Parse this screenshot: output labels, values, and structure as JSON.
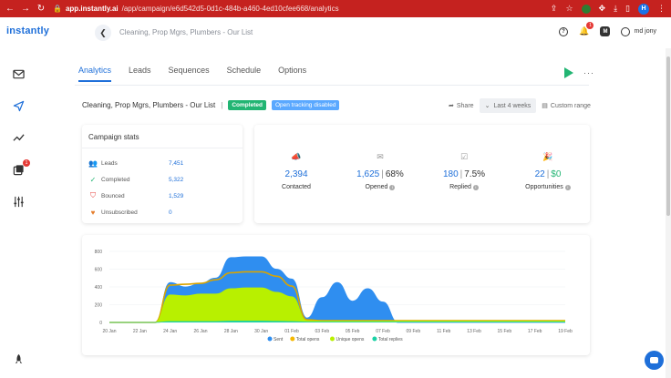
{
  "browser": {
    "domain": "app.instantly.ai",
    "path": "/app/campaign/e6d542d5-0d1c-484b-a460-4ed10cfee668/analytics",
    "notification_count": "1",
    "profile_initial": "H"
  },
  "header": {
    "logo": "instantly",
    "campaign_title": "Cleaning, Prop Mgrs, Plumbers - Our List",
    "notification_count": "1",
    "workspace_initial": "M",
    "user_name": "md jony"
  },
  "sidebar": {
    "items": [
      {
        "name": "inbox-icon"
      },
      {
        "name": "send-icon"
      },
      {
        "name": "analytics-icon"
      },
      {
        "name": "unibox-icon",
        "badge": "1"
      },
      {
        "name": "settings-sliders-icon"
      },
      {
        "name": "rocket-icon"
      }
    ]
  },
  "tabs": [
    {
      "label": "Analytics",
      "active": true
    },
    {
      "label": "Leads",
      "active": false
    },
    {
      "label": "Sequences",
      "active": false
    },
    {
      "label": "Schedule",
      "active": false
    },
    {
      "label": "Options",
      "active": false
    }
  ],
  "campaign": {
    "name": "Cleaning, Prop Mgrs, Plumbers - Our List",
    "separator": "|",
    "status": "Completed",
    "tracking": "Open tracking disabled",
    "share_label": "Share",
    "range_label": "Last 4 weeks",
    "custom_range_label": "Custom range"
  },
  "stats": {
    "title": "Campaign stats",
    "rows": [
      {
        "label": "Leads",
        "value": "7,451"
      },
      {
        "label": "Completed",
        "value": "5,322"
      },
      {
        "label": "Bounced",
        "value": "1,529"
      },
      {
        "label": "Unsubscribed",
        "value": "0"
      }
    ]
  },
  "metrics": {
    "contacted": {
      "value": "2,394",
      "label": "Contacted"
    },
    "opened": {
      "value": "1,625",
      "pct": "68%",
      "label": "Opened"
    },
    "replied": {
      "value": "180",
      "pct": "7.5%",
      "label": "Replied"
    },
    "opportunities": {
      "value": "22",
      "money": "$0",
      "label": "Opportunities"
    }
  },
  "colors": {
    "accent": "#1e6fd9",
    "success": "#22b573",
    "sent": "#2f8ef0",
    "total_opens": "#f5b800",
    "unique_opens": "#b8f000",
    "total_replies": "#1ad1a5"
  },
  "chart_data": {
    "type": "area",
    "ylim": [
      0,
      800
    ],
    "yticks": [
      "0",
      "200",
      "400",
      "600",
      "800"
    ],
    "x": [
      "20 Jan",
      "21 Jan",
      "22 Jan",
      "23 Jan",
      "24 Jan",
      "25 Jan",
      "26 Jan",
      "27 Jan",
      "28 Jan",
      "29 Jan",
      "30 Jan",
      "31 Jan",
      "01 Feb",
      "02 Feb",
      "03 Feb",
      "04 Feb",
      "05 Feb",
      "06 Feb",
      "07 Feb",
      "08 Feb",
      "09 Feb",
      "10 Feb",
      "11 Feb",
      "12 Feb",
      "13 Feb",
      "14 Feb",
      "15 Feb",
      "16 Feb",
      "17 Feb",
      "18 Feb",
      "19 Feb"
    ],
    "xtick_labels": [
      "20 Jan",
      "22 Jan",
      "24 Jan",
      "26 Jan",
      "28 Jan",
      "30 Jan",
      "01 Feb",
      "03 Feb",
      "05 Feb",
      "07 Feb",
      "09 Feb",
      "11 Feb",
      "13 Feb",
      "15 Feb",
      "17 Feb",
      "19 Feb"
    ],
    "series": [
      {
        "name": "Sent",
        "values": [
          0,
          0,
          0,
          0,
          450,
          400,
          440,
          500,
          730,
          740,
          740,
          600,
          490,
          50,
          280,
          450,
          240,
          380,
          230,
          0,
          0,
          0,
          0,
          0,
          0,
          0,
          0,
          0,
          0,
          0,
          0
        ]
      },
      {
        "name": "Total opens",
        "values": [
          0,
          0,
          0,
          0,
          420,
          430,
          440,
          480,
          560,
          570,
          570,
          520,
          410,
          30,
          20,
          20,
          20,
          20,
          20,
          20,
          20,
          20,
          20,
          20,
          20,
          20,
          20,
          20,
          20,
          20,
          20
        ]
      },
      {
        "name": "Unique opens",
        "values": [
          0,
          0,
          0,
          0,
          310,
          300,
          320,
          320,
          380,
          390,
          390,
          340,
          290,
          20,
          15,
          15,
          15,
          15,
          15,
          15,
          15,
          15,
          15,
          15,
          15,
          15,
          15,
          15,
          15,
          15,
          15
        ]
      },
      {
        "name": "Total replies",
        "values": [
          0,
          0,
          0,
          0,
          10,
          10,
          10,
          10,
          15,
          15,
          15,
          12,
          10,
          5,
          5,
          5,
          5,
          5,
          5,
          5,
          5,
          5,
          5,
          5,
          5,
          5,
          5,
          5,
          5,
          5,
          5
        ]
      }
    ],
    "legend_position": "bottom"
  }
}
